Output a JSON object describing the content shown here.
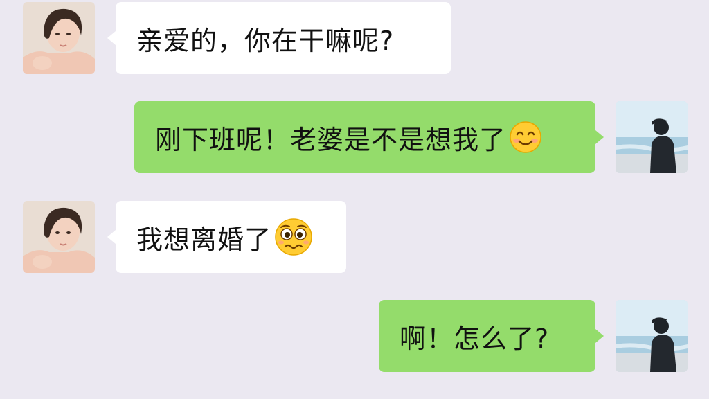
{
  "messages": [
    {
      "side": "in",
      "text": "亲爱的，你在干嘛呢?",
      "emoji": ""
    },
    {
      "side": "out",
      "text": "刚下班呢！老婆是不是想我了",
      "emoji": "smiling-face-icon"
    },
    {
      "side": "in",
      "text": "我想离婚了",
      "emoji": "pleading-face-icon"
    },
    {
      "side": "out",
      "text": "啊！怎么了?",
      "emoji": ""
    }
  ],
  "avatars": {
    "contact": "woman-portrait-avatar",
    "self": "man-silhouette-seaside-avatar"
  },
  "colors": {
    "background": "#ebe8f1",
    "incoming_bubble": "#ffffff",
    "outgoing_bubble": "#94dc6b",
    "text": "#111111"
  }
}
